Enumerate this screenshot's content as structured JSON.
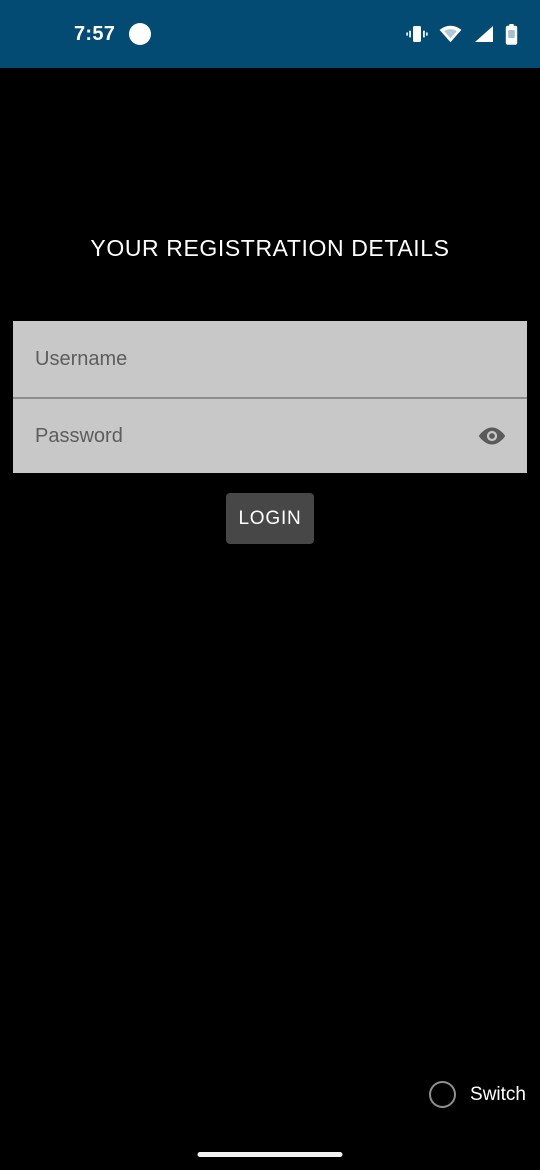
{
  "status_bar": {
    "background_color": "#044b74",
    "time": "7:57",
    "notification_dot": "notification-dot",
    "icons": [
      {
        "name": "vibrate-icon",
        "label": "Vibrate"
      },
      {
        "name": "wifi-icon",
        "label": "Wi-Fi"
      },
      {
        "name": "cellular-signal-icon",
        "label": "Signal"
      },
      {
        "name": "battery-icon",
        "label": "Battery"
      }
    ]
  },
  "screen": {
    "background_color": "#000000",
    "title": "YOUR REGISTRATION DETAILS"
  },
  "form": {
    "field_background_color": "#c8c8c8",
    "divider_color": "#8c8c8c",
    "username": {
      "placeholder": "Username",
      "value": ""
    },
    "password": {
      "placeholder": "Password",
      "value": "",
      "toggle_icon": "eye-icon"
    }
  },
  "login_button": {
    "label": "LOGIN",
    "background_color": "#474747",
    "text_color": "#ffffff"
  },
  "switch_control": {
    "label": "Switch",
    "checked": false
  },
  "navigation": {
    "home_indicator": "home-indicator"
  }
}
